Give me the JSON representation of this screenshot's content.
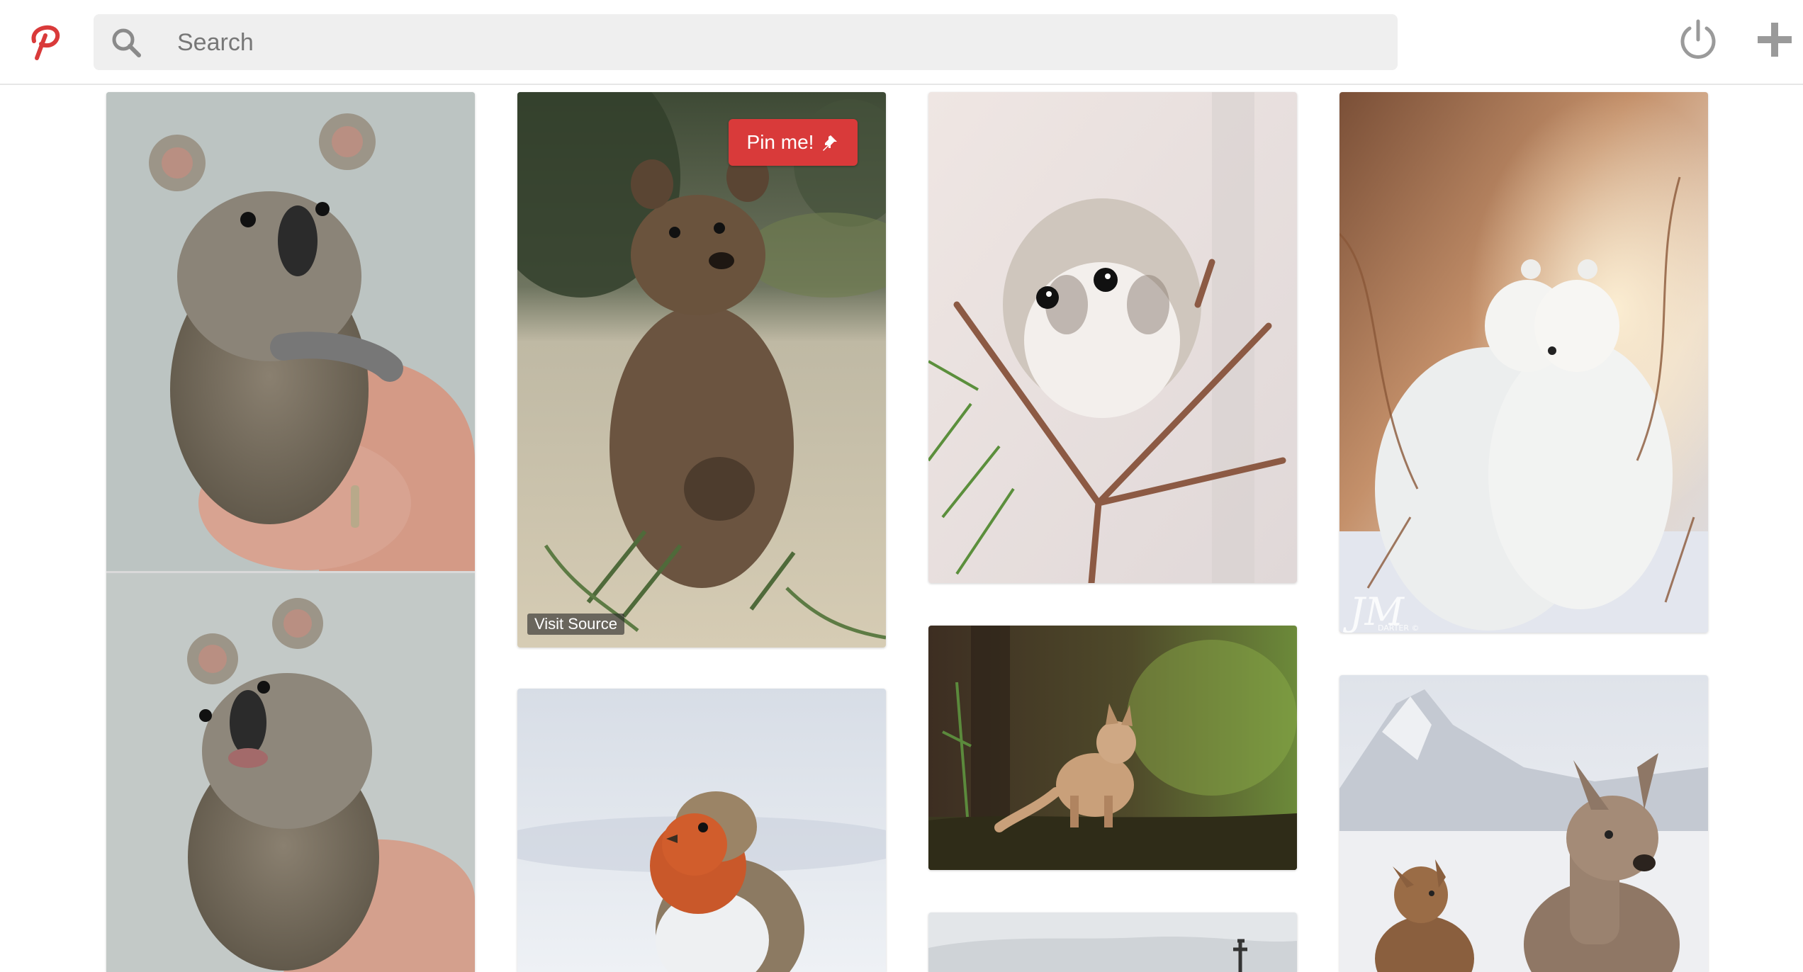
{
  "header": {
    "logo_icon": "pinterest-p-icon",
    "brand_color": "#d93a3a",
    "search": {
      "placeholder": "Search",
      "value": "",
      "icon": "search-icon"
    },
    "actions": [
      {
        "icon": "power-icon"
      },
      {
        "icon": "plus-icon"
      }
    ]
  },
  "pins": [
    {
      "subject": "koala-joey"
    },
    {
      "subject": "quokka",
      "hover": {
        "pin_button_label": "Pin me!",
        "pin_button_icon": "pushpin-icon",
        "visit_label": "Visit Source"
      }
    },
    {
      "subject": "bird"
    },
    {
      "subject": "flying-squirrel"
    },
    {
      "subject": "fox-cub"
    },
    {
      "subject": "snowy-landscape"
    },
    {
      "subject": "polar-bears",
      "watermark": "JM DARTER ©"
    },
    {
      "subject": "deer"
    }
  ]
}
